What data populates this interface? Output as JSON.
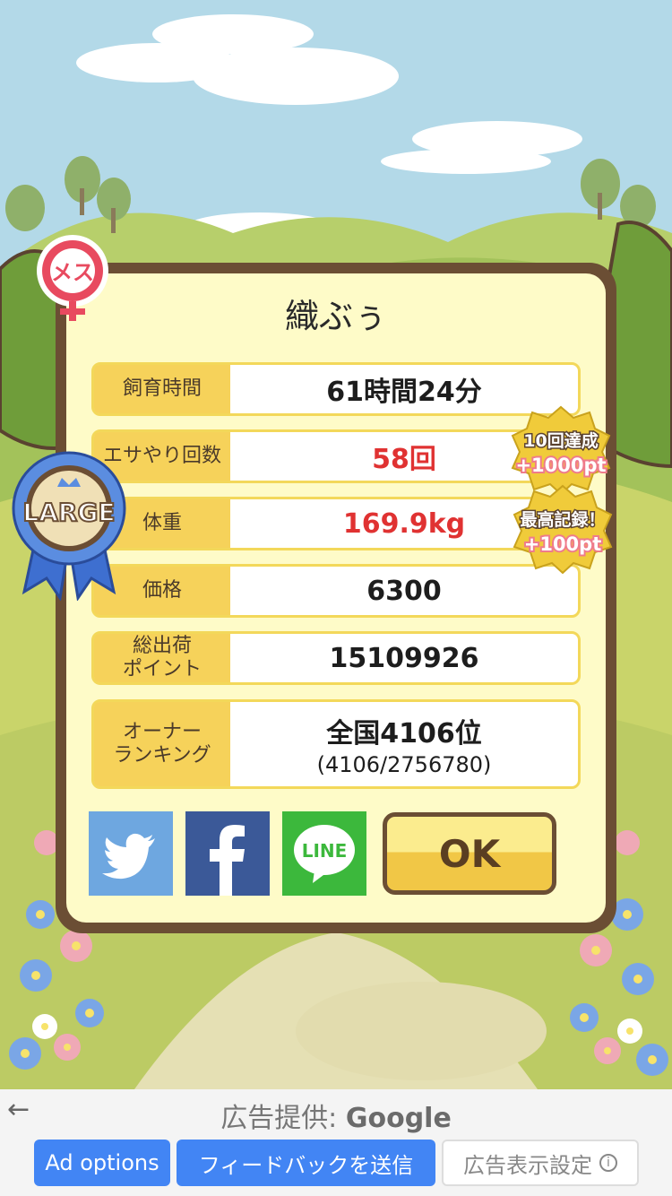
{
  "pet": {
    "name": "織ぶぅ",
    "gender_badge": "メス",
    "size_ribbon": "LARGE"
  },
  "stats": [
    {
      "label": "飼育時間",
      "value": "61時間24分"
    },
    {
      "label": "エサやり回数",
      "value": "58回"
    },
    {
      "label": "体重",
      "value": "169.9kg"
    },
    {
      "label": "価格",
      "value": "6300"
    },
    {
      "label": "総出荷\nポイント",
      "value": "15109926"
    },
    {
      "label": "オーナー\nランキング",
      "value": "全国4106位",
      "sub": "(4106/2756780)"
    }
  ],
  "bonuses": [
    {
      "line1": "10回達成",
      "line2": "+1000pt"
    },
    {
      "line1": "最高記録！",
      "line2": "+100pt"
    }
  ],
  "share": {
    "twitter": "twitter-icon",
    "facebook": "facebook-icon",
    "line_label": "LINE"
  },
  "ok_label": "OK",
  "ad": {
    "provider_prefix": "広告提供: ",
    "provider_brand": "Google",
    "back_icon": "back-arrow-icon",
    "options_label": "Ad options",
    "feedback_label": "フィードバックを送信",
    "settings_label": "広告表示設定",
    "info_icon": "info-icon"
  },
  "colors": {
    "panel_border": "#6b4e34",
    "panel_fill": "#fefbc8",
    "label_fill": "#f6d25a",
    "highlight_red": "#e03232",
    "twitter": "#6ea7e0",
    "facebook": "#3b5998",
    "line": "#3cb83c",
    "ad_blue": "#4285f4"
  }
}
